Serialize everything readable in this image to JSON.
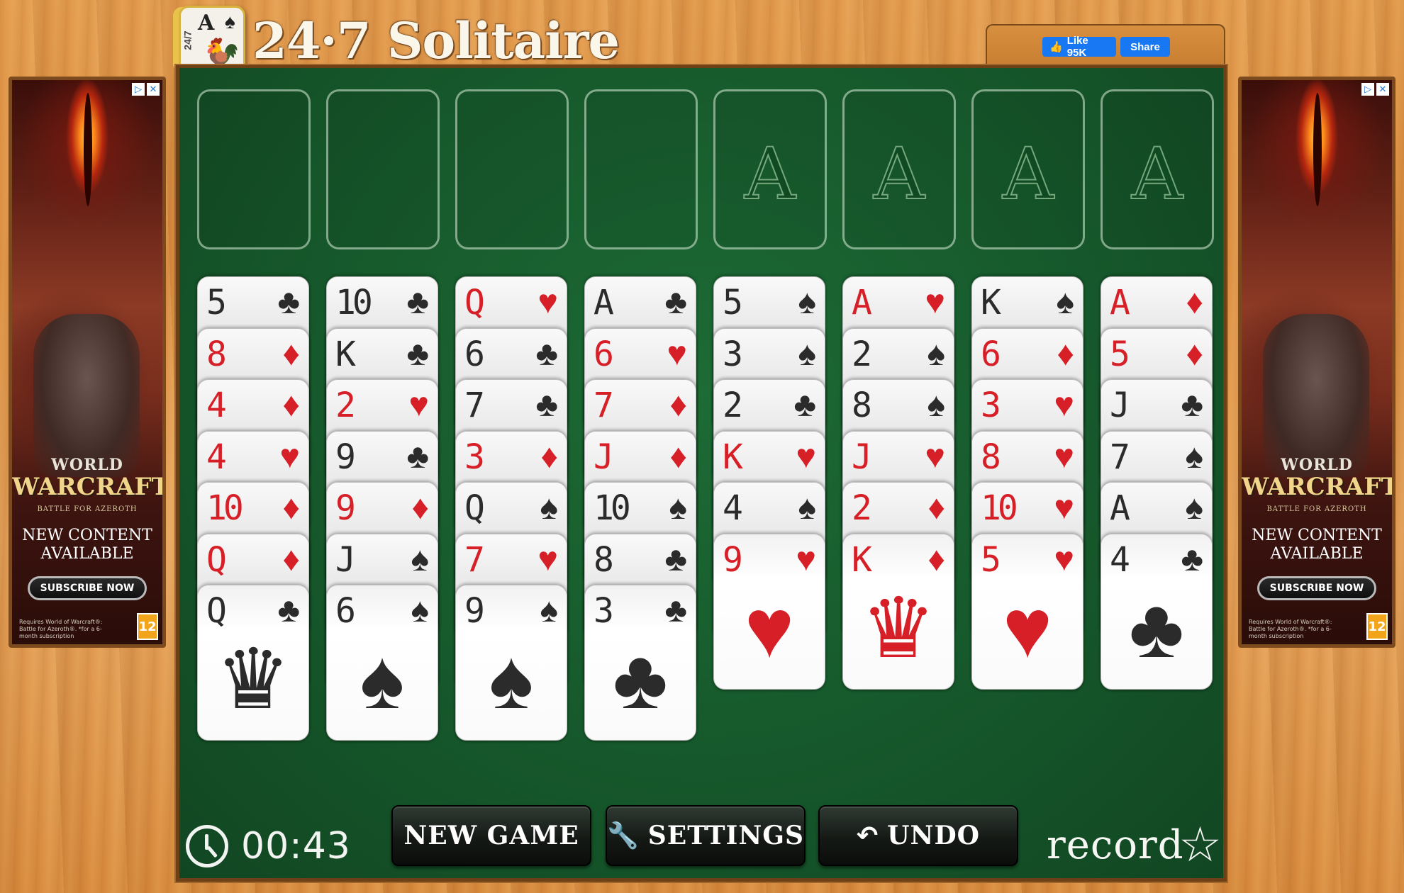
{
  "header": {
    "logo_rank": "A",
    "logo_suit": "♠",
    "logo_side": "24/7",
    "title": "24·7 Solitaire",
    "facebook": {
      "like_label": "Like 95K",
      "share_label": "Share"
    }
  },
  "ad": {
    "brand_top": "WORLD",
    "brand_main": "WARCRAFT",
    "brand_sub": "BATTLE FOR AZEROTH",
    "headline": "NEW CONTENT AVAILABLE",
    "cta": "SUBSCRIBE NOW",
    "fine_print": "Requires World of Warcraft®: Battle for Azeroth®. *for a 6-month subscription",
    "rating": "12"
  },
  "free_cells": [
    "",
    "",
    "",
    ""
  ],
  "foundations": [
    {
      "label": "A"
    },
    {
      "label": "A"
    },
    {
      "label": "A"
    },
    {
      "label": "A"
    }
  ],
  "tableau": [
    [
      {
        "rank": "5",
        "suit": "♣",
        "color": "black"
      },
      {
        "rank": "8",
        "suit": "♦",
        "color": "red"
      },
      {
        "rank": "4",
        "suit": "♦",
        "color": "red"
      },
      {
        "rank": "4",
        "suit": "♥",
        "color": "red"
      },
      {
        "rank": "10",
        "suit": "♦",
        "color": "red"
      },
      {
        "rank": "Q",
        "suit": "♦",
        "color": "red"
      },
      {
        "rank": "Q",
        "suit": "♣",
        "color": "black",
        "center": "♛"
      }
    ],
    [
      {
        "rank": "10",
        "suit": "♣",
        "color": "black"
      },
      {
        "rank": "K",
        "suit": "♣",
        "color": "black"
      },
      {
        "rank": "2",
        "suit": "♥",
        "color": "red"
      },
      {
        "rank": "9",
        "suit": "♣",
        "color": "black"
      },
      {
        "rank": "9",
        "suit": "♦",
        "color": "red"
      },
      {
        "rank": "J",
        "suit": "♠",
        "color": "black"
      },
      {
        "rank": "6",
        "suit": "♠",
        "color": "black",
        "center": "♠"
      }
    ],
    [
      {
        "rank": "Q",
        "suit": "♥",
        "color": "red"
      },
      {
        "rank": "6",
        "suit": "♣",
        "color": "black"
      },
      {
        "rank": "7",
        "suit": "♣",
        "color": "black"
      },
      {
        "rank": "3",
        "suit": "♦",
        "color": "red"
      },
      {
        "rank": "Q",
        "suit": "♠",
        "color": "black"
      },
      {
        "rank": "7",
        "suit": "♥",
        "color": "red"
      },
      {
        "rank": "9",
        "suit": "♠",
        "color": "black",
        "center": "♠"
      }
    ],
    [
      {
        "rank": "A",
        "suit": "♣",
        "color": "black"
      },
      {
        "rank": "6",
        "suit": "♥",
        "color": "red"
      },
      {
        "rank": "7",
        "suit": "♦",
        "color": "red"
      },
      {
        "rank": "J",
        "suit": "♦",
        "color": "red"
      },
      {
        "rank": "10",
        "suit": "♠",
        "color": "black"
      },
      {
        "rank": "8",
        "suit": "♣",
        "color": "black"
      },
      {
        "rank": "3",
        "suit": "♣",
        "color": "black",
        "center": "♣"
      }
    ],
    [
      {
        "rank": "5",
        "suit": "♠",
        "color": "black"
      },
      {
        "rank": "3",
        "suit": "♠",
        "color": "black"
      },
      {
        "rank": "2",
        "suit": "♣",
        "color": "black"
      },
      {
        "rank": "K",
        "suit": "♥",
        "color": "red"
      },
      {
        "rank": "4",
        "suit": "♠",
        "color": "black"
      },
      {
        "rank": "9",
        "suit": "♥",
        "color": "red",
        "center": "♥"
      }
    ],
    [
      {
        "rank": "A",
        "suit": "♥",
        "color": "red"
      },
      {
        "rank": "2",
        "suit": "♠",
        "color": "black"
      },
      {
        "rank": "8",
        "suit": "♠",
        "color": "black"
      },
      {
        "rank": "J",
        "suit": "♥",
        "color": "red"
      },
      {
        "rank": "2",
        "suit": "♦",
        "color": "red"
      },
      {
        "rank": "K",
        "suit": "♦",
        "color": "red",
        "center": "♛"
      }
    ],
    [
      {
        "rank": "K",
        "suit": "♠",
        "color": "black"
      },
      {
        "rank": "6",
        "suit": "♦",
        "color": "red"
      },
      {
        "rank": "3",
        "suit": "♥",
        "color": "red"
      },
      {
        "rank": "8",
        "suit": "♥",
        "color": "red"
      },
      {
        "rank": "10",
        "suit": "♥",
        "color": "red"
      },
      {
        "rank": "5",
        "suit": "♥",
        "color": "red",
        "center": "♥"
      }
    ],
    [
      {
        "rank": "A",
        "suit": "♦",
        "color": "red"
      },
      {
        "rank": "5",
        "suit": "♦",
        "color": "red"
      },
      {
        "rank": "J",
        "suit": "♣",
        "color": "black"
      },
      {
        "rank": "7",
        "suit": "♠",
        "color": "black"
      },
      {
        "rank": "A",
        "suit": "♠",
        "color": "black"
      },
      {
        "rank": "4",
        "suit": "♣",
        "color": "black",
        "center": "♣"
      }
    ]
  ],
  "controls": {
    "timer": "00:43",
    "new_game": "NEW GAME",
    "settings": "SETTINGS",
    "undo": "UNDO",
    "record": "record"
  },
  "colors": {
    "felt": "#16582b",
    "red_suit": "#d61f26",
    "black_suit": "#2b2b2b",
    "wood": "#e39a4c"
  },
  "icons": {
    "clock": "clock-icon",
    "settings": "wrench-icon",
    "undo": "undo-icon",
    "record": "star-icon"
  }
}
